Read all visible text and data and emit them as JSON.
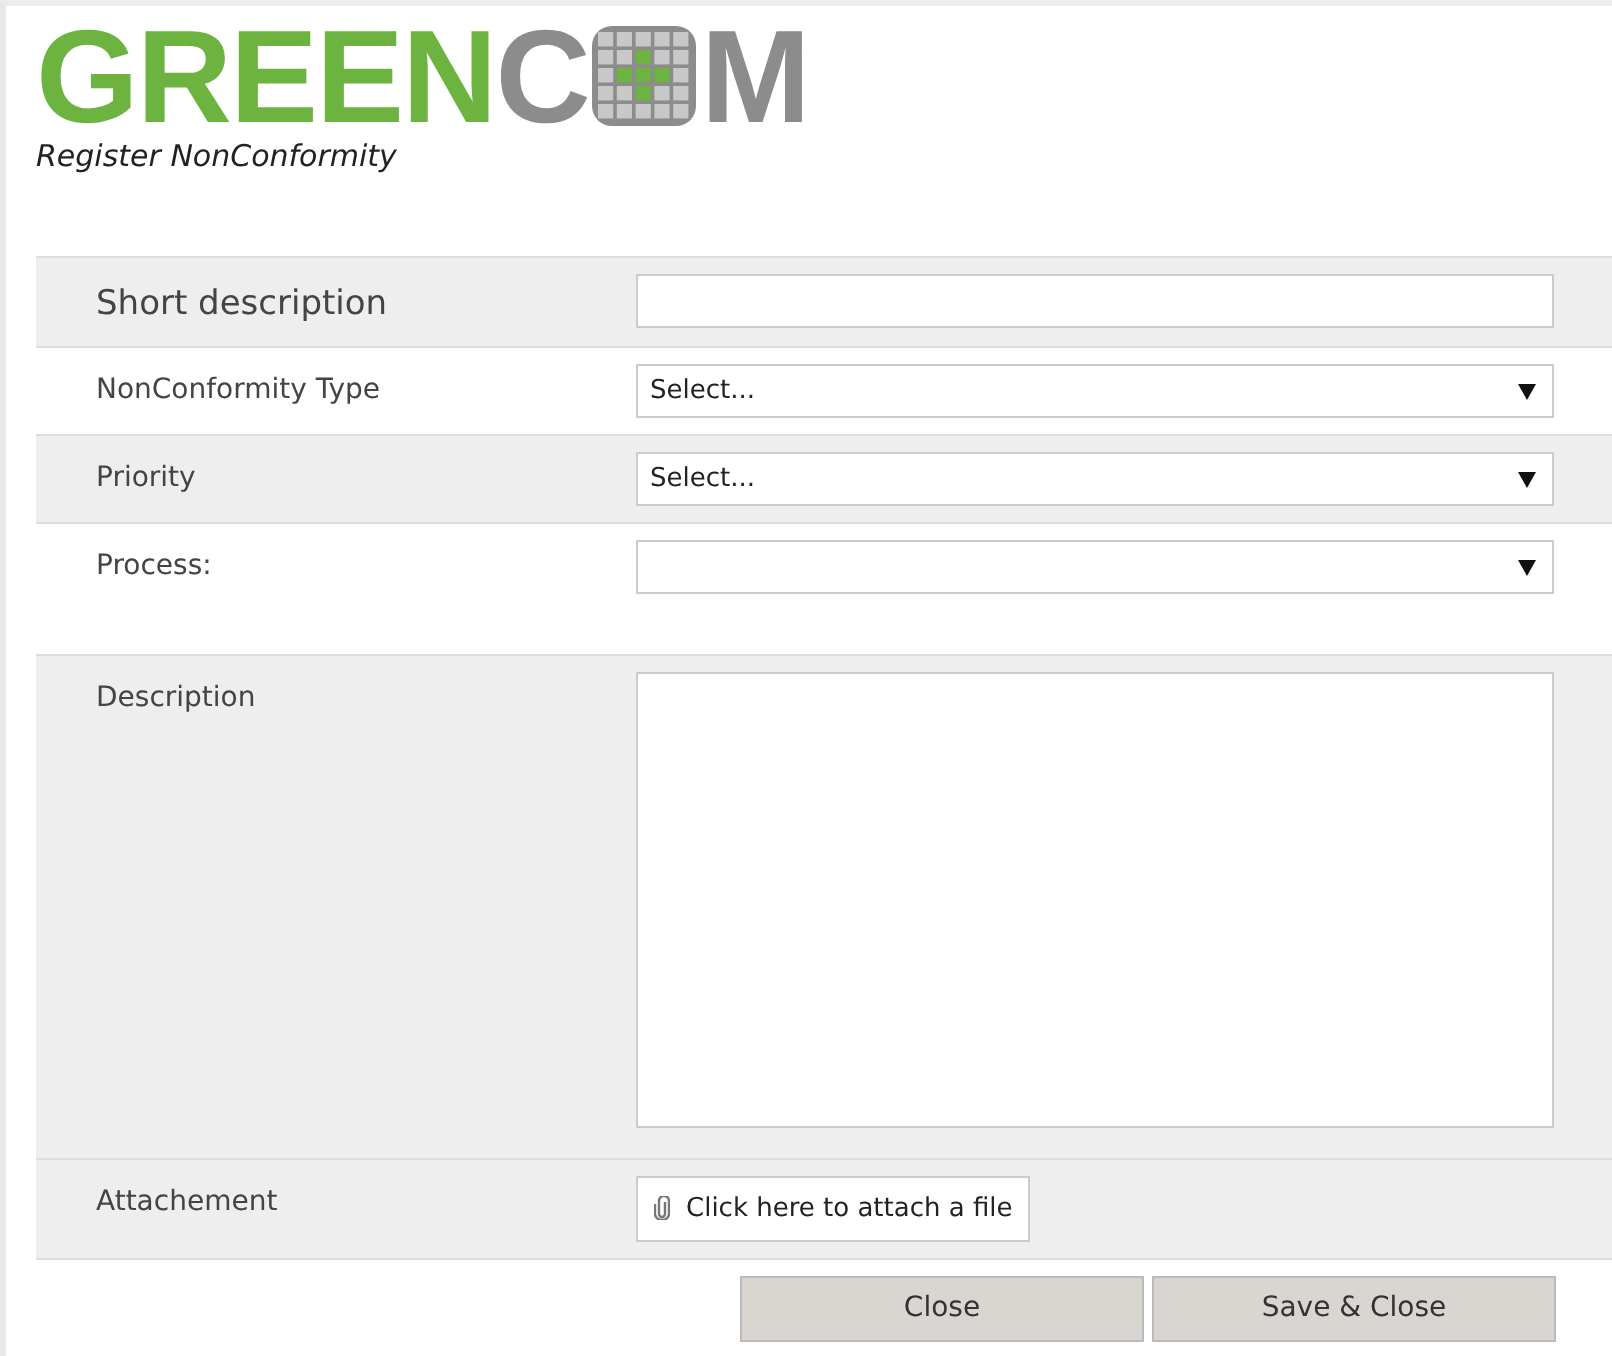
{
  "logo": {
    "parts": [
      {
        "kind": "text",
        "text": "GREEN",
        "color": "#6cb33f"
      },
      {
        "kind": "text",
        "text": "C",
        "color": "#8c8c8c"
      },
      {
        "kind": "grid",
        "color": "#8c8c8c"
      },
      {
        "kind": "text",
        "text": "M",
        "color": "#8c8c8c"
      }
    ]
  },
  "subtitle": "Register NonConformity",
  "fields": [
    {
      "kind": "text",
      "label": "Short description",
      "large": true,
      "shaded": true
    },
    {
      "kind": "select",
      "label": "NonConformity Type",
      "value": "Select...",
      "large": false,
      "shaded": false
    },
    {
      "kind": "select",
      "label": "Priority",
      "value": "Select...",
      "large": false,
      "shaded": true
    },
    {
      "kind": "select",
      "label": "Process:",
      "large": false,
      "shaded": false
    },
    {
      "kind": "textarea",
      "label": "Description",
      "large": false,
      "shaded": true
    },
    {
      "kind": "file",
      "label": "Attachement",
      "value": "Click here to attach a file",
      "large": false,
      "shaded": true
    }
  ],
  "buttons": [
    "Close",
    "Save & Close"
  ]
}
